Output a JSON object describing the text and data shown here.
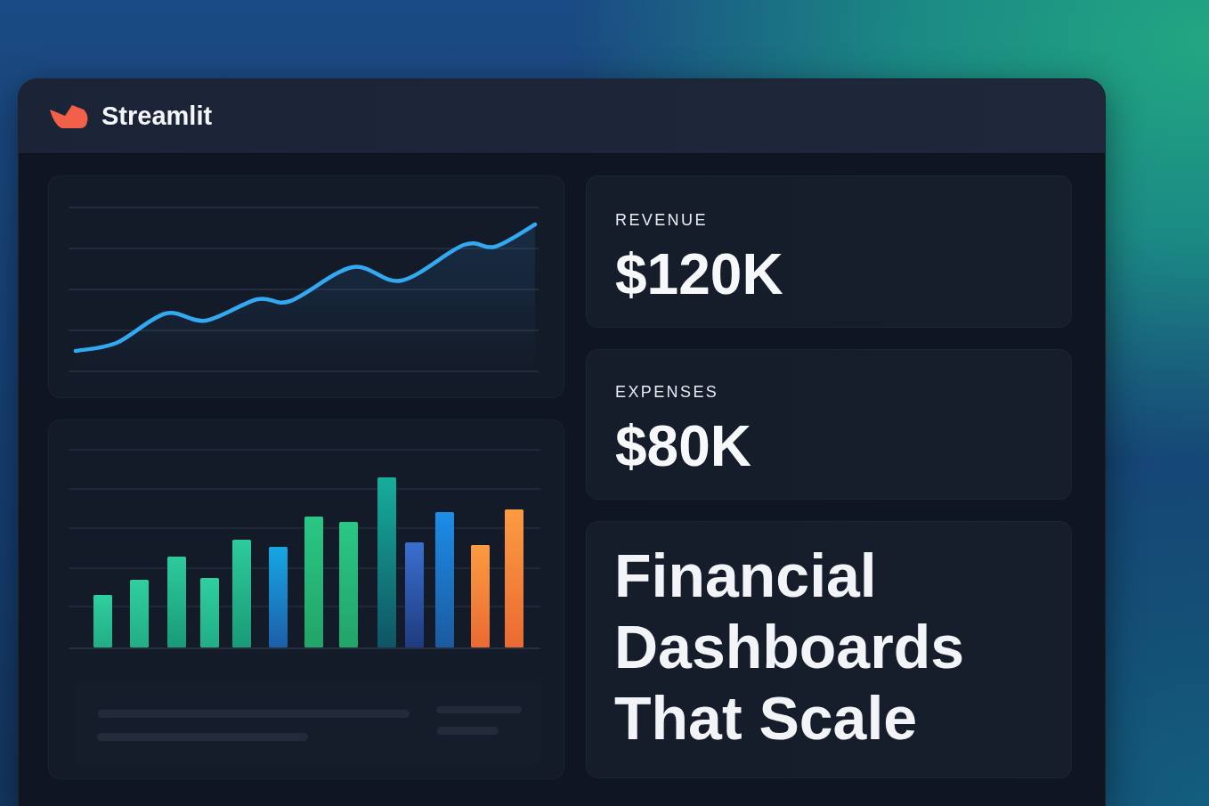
{
  "window": {
    "brand": "Streamlit"
  },
  "metrics": [
    {
      "label": "REVENUE",
      "value": "$120K"
    },
    {
      "label": "EXPENSES",
      "value": "$80K"
    }
  ],
  "headline": "Financial Dashboards That Scale"
}
